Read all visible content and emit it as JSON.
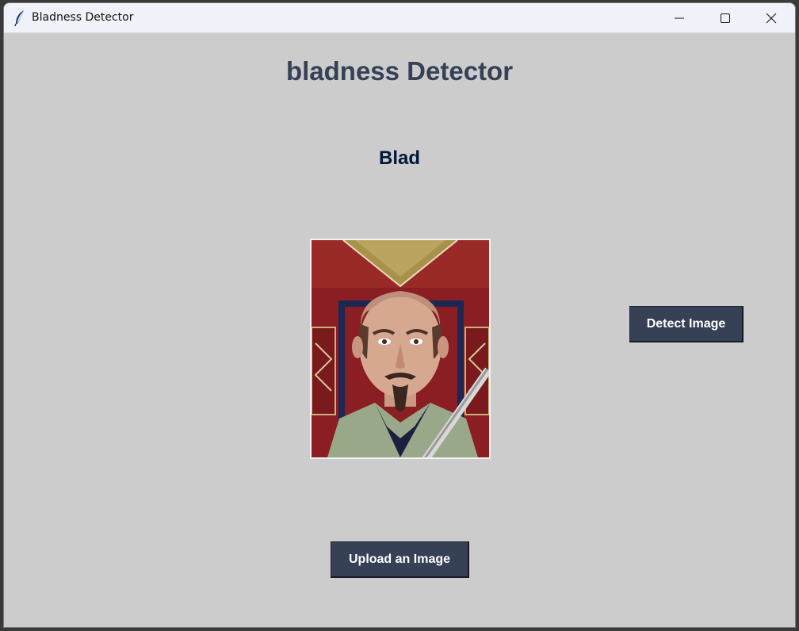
{
  "window": {
    "title": "Bladness Detector",
    "icon": "feather-icon",
    "controls": [
      "minimize-icon",
      "maximize-icon",
      "close-icon"
    ]
  },
  "main": {
    "heading": "bladness Detector",
    "result_label": "Blad",
    "photo": {
      "description_icon": "portrait-image"
    },
    "detect_button": "Detect Image",
    "upload_button": "Upload an Image"
  },
  "colors": {
    "background": "#cccccc",
    "heading": "#364156",
    "result": "#011638",
    "button_bg": "#364156",
    "button_text": "#ffffff"
  }
}
